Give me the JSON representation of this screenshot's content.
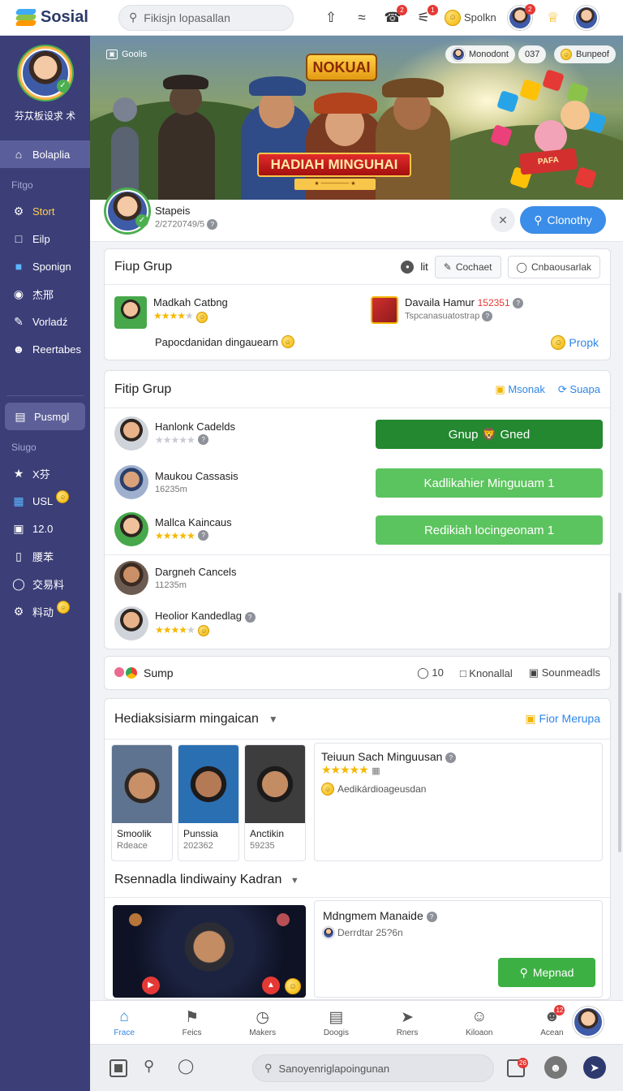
{
  "app": {
    "name": "Sosial"
  },
  "topbar": {
    "search_placeholder": "Fikisjn lopasallan",
    "coin_label": "Spolkn",
    "notif_badge": "2",
    "chat_badge": "1",
    "profile_badge": "2"
  },
  "sidebar": {
    "profile_name": "芬苁板设求 术",
    "active": "Bolaplia",
    "section1": "Fitgo",
    "items1": [
      {
        "icon": "gear-icon",
        "label": "Stort"
      },
      {
        "icon": "edit-icon",
        "label": "Eilp"
      },
      {
        "icon": "folder-icon",
        "label": "Sponign"
      },
      {
        "icon": "record-icon",
        "label": "杰邢"
      },
      {
        "icon": "pen-icon",
        "label": "Vorladź"
      },
      {
        "icon": "user-icon",
        "label": "Reertabes"
      }
    ],
    "pill_label": "Pusmgl",
    "section2": "Siugo",
    "items2": [
      {
        "icon": "star-icon",
        "label": "X芬"
      },
      {
        "icon": "grid-icon",
        "label": "USL"
      },
      {
        "icon": "inbox-icon",
        "label": "12.0"
      },
      {
        "icon": "note-icon",
        "label": "腰苯"
      },
      {
        "icon": "circle-icon",
        "label": "交易料"
      },
      {
        "icon": "gear-icon",
        "label": "料动"
      }
    ]
  },
  "banner": {
    "chip_left": "Goolis",
    "chip_right_1": "Monodont",
    "chip_right_2": "037",
    "chip_right_3": "Bunpeof",
    "title_badge": "NOKUAI",
    "ribbon": "HADIAH MINGUHAI",
    "ribbon_sub": "★ ─────── ★",
    "gift_text": "PAFA"
  },
  "profile_strip": {
    "name": "Stapeis",
    "sub": "2/2720749/5",
    "primary_button": "Clonothy"
  },
  "card1": {
    "title": "Fiup Grup",
    "toggle_label": "lit",
    "btn1": "Cochaet",
    "btn2": "Cnbaousarlak",
    "item1_name": "Madkah Catbng",
    "item1_rating": 4,
    "item1_desc": "Papocdanidan dingauearn",
    "item2_name": "Davaila Hamur",
    "item2_count": "152351",
    "item2_sub": "Tspcanasuatostrap",
    "link": "Propk"
  },
  "card2": {
    "title": "Fitip Grup",
    "action1": "Msonak",
    "action2": "Suapa",
    "rows": [
      {
        "name": "Hanlonk Cadelds",
        "sub": "",
        "rating": 0
      },
      {
        "name": "Maukou Cassasis",
        "sub": "16235m",
        "rating": null
      },
      {
        "name": "Mallca Kaincaus",
        "sub": "",
        "rating": 5
      },
      {
        "name": "Dargneh Cancels",
        "sub": "11235m",
        "rating": null
      },
      {
        "name": "Heolior Kandedlag",
        "sub": "",
        "rating": 4
      }
    ],
    "btn1": "Gnup 🦁 Gned",
    "btn2": "Kadlikahier Minguuam 1",
    "btn3": "Redikiah locingeonam 1"
  },
  "card3": {
    "label": "Sump",
    "count": "10",
    "btn1": "Knonallal",
    "btn2": "Sounmeadls"
  },
  "card4": {
    "title": "Hediaksisiarm mingaican",
    "action": "Fior Merupa",
    "people": [
      {
        "name": "Smoolik",
        "sub": "Rdeace"
      },
      {
        "name": "Punssia",
        "sub": "202362"
      },
      {
        "name": "Anctikin",
        "sub": "59235"
      }
    ],
    "detail_title": "Teiuun Sach Minguusan",
    "detail_rating": 5,
    "detail_desc": "Aedikárdioageusdan",
    "section2_title": "Rsennadla lindiwainy Kadran",
    "detail2_title": "Mdngmem Manaide",
    "detail2_sub": "Derrdtar 25?6n",
    "detail2_btn": "Mepnad"
  },
  "tabbar": {
    "tabs": [
      {
        "label": "Frace",
        "icon": "home-icon"
      },
      {
        "label": "Feics",
        "icon": "flag-icon"
      },
      {
        "label": "Makers",
        "icon": "clock-icon"
      },
      {
        "label": "Doogis",
        "icon": "chart-icon"
      },
      {
        "label": "Rners",
        "icon": "send-icon"
      },
      {
        "label": "Kiloaon",
        "icon": "user-icon"
      },
      {
        "label": "Acean",
        "icon": "smile-icon",
        "badge": "12"
      }
    ]
  },
  "bottombar": {
    "search_placeholder": "Sanoyenriglapoingunan",
    "badge": "26"
  }
}
